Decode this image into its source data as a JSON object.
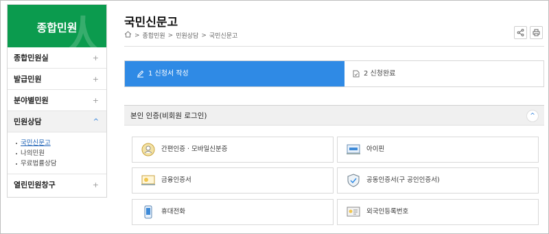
{
  "sidebar": {
    "header_title": "종합민원",
    "items": [
      {
        "label": "종합민원실",
        "sign": "+"
      },
      {
        "label": "발급민원",
        "sign": "+"
      },
      {
        "label": "분야별민원",
        "sign": "+"
      },
      {
        "label": "민원상담",
        "sign": "^"
      }
    ],
    "sub_items": [
      "국민신문고",
      "나의민원",
      "무료법률상담"
    ],
    "last_item": {
      "label": "열린민원창구",
      "sign": "+"
    }
  },
  "page": {
    "title": "국민신문고",
    "breadcrumb": [
      "종합민원",
      "민원상담",
      "국민신문고"
    ],
    "breadcrumb_separator": ">"
  },
  "steps": {
    "step1": "1 신청서 작성",
    "step2": "2 신청완료"
  },
  "auth": {
    "header": "본인 인증(비회원 로그인)",
    "toggle": "^",
    "options": [
      {
        "label": "간편인증 · 모바일신분증",
        "icon": "simple-auth-icon"
      },
      {
        "label": "아이핀",
        "icon": "ipin-icon"
      },
      {
        "label": "금융인증서",
        "icon": "financial-cert-icon"
      },
      {
        "label": "공동인증서(구 공인인증서)",
        "icon": "joint-cert-icon"
      },
      {
        "label": "휴대전화",
        "icon": "mobile-phone-icon"
      },
      {
        "label": "외국인등록번호",
        "icon": "foreigner-id-icon"
      }
    ]
  },
  "colors": {
    "sidebar_header": "#0b9b4e",
    "step_active": "#2f8ae5",
    "link_active": "#1a5fb4"
  }
}
